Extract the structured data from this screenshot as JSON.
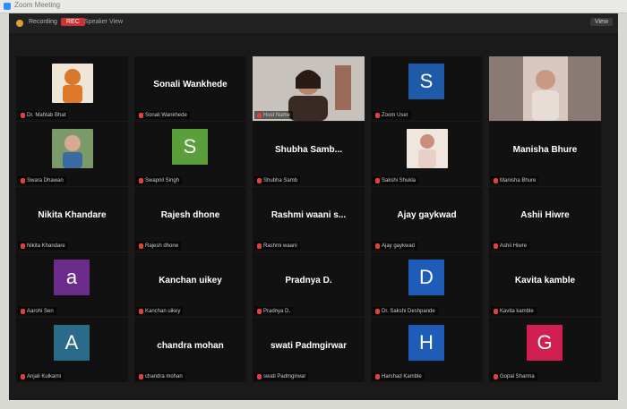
{
  "window": {
    "title": "Zoom Meeting",
    "meeting_label": "Recording",
    "rec_label": "REC",
    "speaker_view": "Speaker View",
    "view_label": "View"
  },
  "colors": {
    "purple": "#6a2b8a",
    "blue": "#1f5aa8",
    "green": "#5a9f3a",
    "teal": "#2a6b8a",
    "red": "#d01f50",
    "blue2": "#1f5cb8"
  },
  "participants": [
    {
      "name": "",
      "label": "Dr. Mahtab Bhat",
      "type": "photo",
      "photo": "orange"
    },
    {
      "name": "Sonali Wankhede",
      "label": "Sonali Wankhede",
      "type": "name"
    },
    {
      "name": "",
      "label": "Host Name",
      "type": "video",
      "photo": "woman"
    },
    {
      "name": "",
      "label": "Zoom User",
      "type": "avatar",
      "letter": "S",
      "color": "blue"
    },
    {
      "name": "",
      "label": "",
      "type": "video",
      "photo": "man",
      "active": true
    },
    {
      "name": "",
      "label": "Swara Dhawan",
      "type": "photo",
      "photo": "girl"
    },
    {
      "name": "",
      "label": "Swapnil Singh",
      "type": "avatar",
      "letter": "S",
      "color": "green"
    },
    {
      "name": "Shubha Samb...",
      "label": "Shubha Samb",
      "type": "name"
    },
    {
      "name": "",
      "label": "Sakshi Shukla",
      "type": "photo",
      "photo": "person"
    },
    {
      "name": "Manisha Bhure",
      "label": "Manisha Bhure",
      "type": "name"
    },
    {
      "name": "Nikita Khandare",
      "label": "Nikita Khandare",
      "type": "name"
    },
    {
      "name": "Rajesh dhone",
      "label": "Rajesh dhone",
      "type": "name"
    },
    {
      "name": "Rashmi waani s...",
      "label": "Rashmi waani",
      "type": "name"
    },
    {
      "name": "Ajay gaykwad",
      "label": "Ajay gaykwad",
      "type": "name"
    },
    {
      "name": "Ashii Hiwre",
      "label": "Ashii Hiwre",
      "type": "name"
    },
    {
      "name": "",
      "label": "Aarohi Sen",
      "type": "avatar",
      "letter": "a",
      "color": "purple"
    },
    {
      "name": "Kanchan uikey",
      "label": "Kanchan uikey",
      "type": "name"
    },
    {
      "name": "Pradnya D.",
      "label": "Pradnya D.",
      "type": "name"
    },
    {
      "name": "",
      "label": "Dr. Sakshi Deshpande",
      "type": "avatar",
      "letter": "D",
      "color": "blue2"
    },
    {
      "name": "Kavita kamble",
      "label": "Kavita kamble",
      "type": "name"
    },
    {
      "name": "",
      "label": "Anjali Kulkarni",
      "type": "avatar",
      "letter": "A",
      "color": "teal"
    },
    {
      "name": "chandra mohan",
      "label": "chandra mohan",
      "type": "name"
    },
    {
      "name": "swati Padmgirwar",
      "label": "swati Padmgirwar",
      "type": "name"
    },
    {
      "name": "",
      "label": "Harshad Kamble",
      "type": "avatar",
      "letter": "H",
      "color": "blue2"
    },
    {
      "name": "",
      "label": "Gopal Sharma",
      "type": "avatar",
      "letter": "G",
      "color": "red"
    }
  ]
}
